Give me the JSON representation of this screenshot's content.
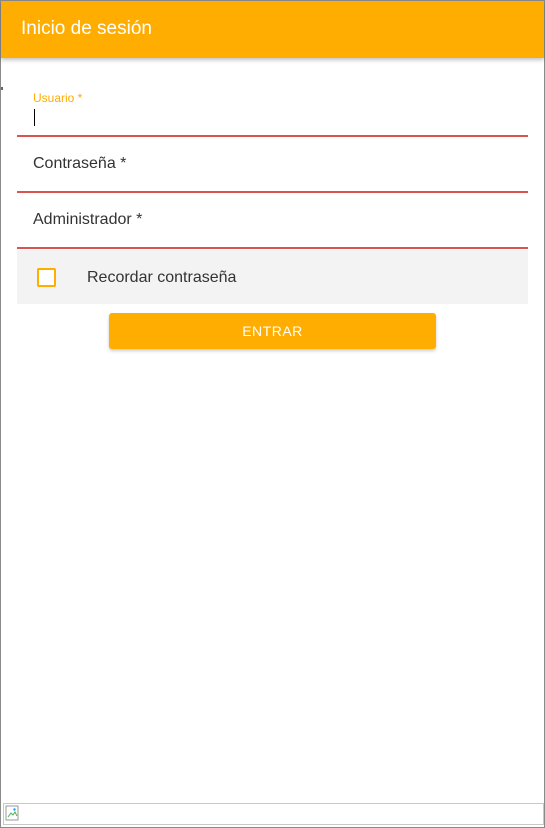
{
  "header": {
    "title": "Inicio de sesión"
  },
  "form": {
    "usuario_label": "Usuario *",
    "contrasena_label": "Contraseña *",
    "administrador_label": "Administrador *",
    "remember_label": "Recordar contraseña",
    "remember_checked": false,
    "submit_label": "ENTRAR"
  },
  "icons": {
    "checkbox": "checkbox-unchecked-icon",
    "broken_image": "broken-image-icon"
  },
  "colors": {
    "primary": "#ffad00",
    "error_underline": "#d9534f",
    "checkrow_bg": "#f3f3f3"
  }
}
